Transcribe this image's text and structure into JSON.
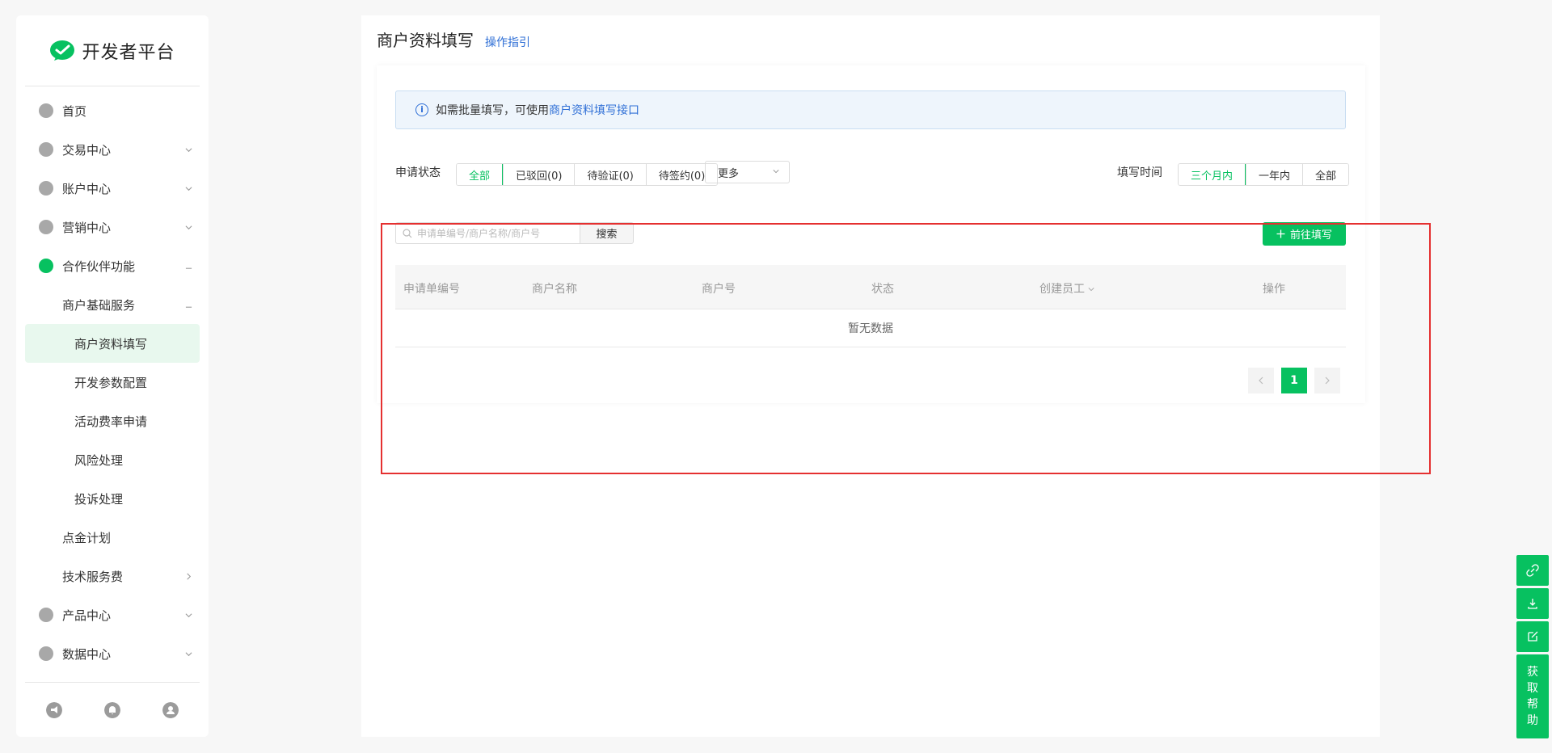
{
  "brand": {
    "name": "开发者平台"
  },
  "sidebar": {
    "items": [
      {
        "label": "首页"
      },
      {
        "label": "交易中心"
      },
      {
        "label": "账户中心"
      },
      {
        "label": "营销中心"
      },
      {
        "label": "合作伙伴功能"
      },
      {
        "label": "商户基础服务"
      },
      {
        "label": "商户资料填写"
      },
      {
        "label": "开发参数配置"
      },
      {
        "label": "活动费率申请"
      },
      {
        "label": "风险处理"
      },
      {
        "label": "投诉处理"
      },
      {
        "label": "点金计划"
      },
      {
        "label": "技术服务费"
      },
      {
        "label": "产品中心"
      },
      {
        "label": "数据中心"
      }
    ],
    "footer_icons": [
      "megaphone-icon",
      "bell-icon",
      "user-icon"
    ]
  },
  "header": {
    "title": "商户资料填写",
    "guide_link": "操作指引"
  },
  "notice": {
    "text": "如需批量填写，可使用",
    "link": "商户资料填写接口"
  },
  "filters": {
    "status_label": "申请状态",
    "status_options": [
      "全部",
      "已驳回(0)",
      "待验证(0)",
      "待签约(0)"
    ],
    "status_selected": "全部",
    "more_label": "更多",
    "time_label": "填写时间",
    "time_options": [
      "三个月内",
      "一年内",
      "全部"
    ],
    "time_selected": "三个月内"
  },
  "search": {
    "placeholder": "申请单编号/商户名称/商户号",
    "button": "搜索"
  },
  "primary_action": {
    "label": "前往填写"
  },
  "table": {
    "columns": [
      "申请单编号",
      "商户名称",
      "商户号",
      "状态",
      "创建员工",
      "操作"
    ],
    "empty_text": "暂无数据"
  },
  "pagination": {
    "current": "1"
  },
  "float_bar": {
    "help_label": [
      "获",
      "取",
      "帮",
      "助"
    ]
  },
  "colors": {
    "accent": "#07c160",
    "link": "#2f6fd6",
    "highlight": "#e53030"
  }
}
